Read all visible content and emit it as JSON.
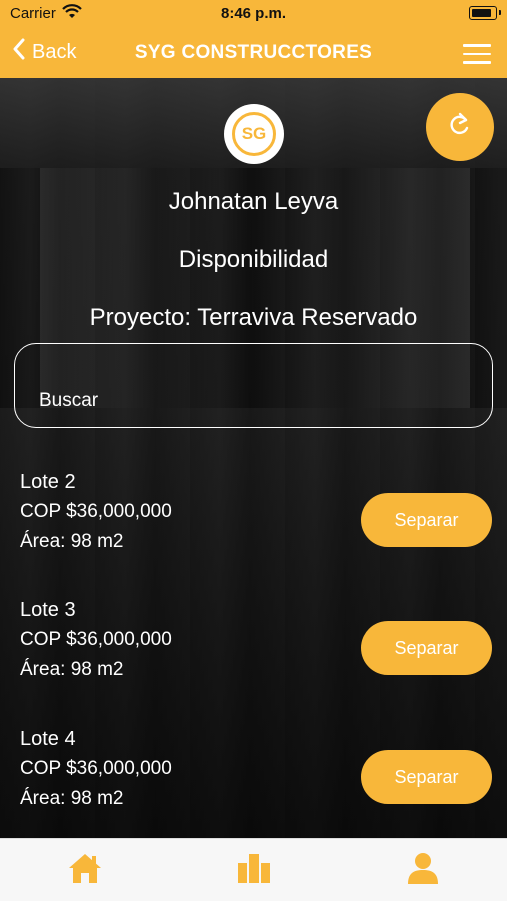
{
  "status_bar": {
    "carrier": "Carrier",
    "time": "8:46 p.m."
  },
  "nav": {
    "back_label": "Back",
    "title": "SYG CONSTRUCCTORES"
  },
  "logo": {
    "text": "SG"
  },
  "profile": {
    "name": "Johnatan Leyva",
    "section": "Disponibilidad",
    "project": "Proyecto: Terraviva Reservado"
  },
  "search": {
    "placeholder": "Buscar",
    "value": ""
  },
  "lots": [
    {
      "name": "Lote 2",
      "price": "COP $36,000,000",
      "area": "Área: 98 m2",
      "button": "Separar"
    },
    {
      "name": "Lote 3",
      "price": "COP $36,000,000",
      "area": "Área: 98 m2",
      "button": "Separar"
    },
    {
      "name": "Lote 4",
      "price": "COP $36,000,000",
      "area": "Área: 98 m2",
      "button": "Separar"
    }
  ],
  "tabs": [
    {
      "icon": "home-icon"
    },
    {
      "icon": "buildings-icon"
    },
    {
      "icon": "user-icon"
    }
  ],
  "colors": {
    "accent": "#f8b73a",
    "text": "#ffffff",
    "tabbar": "#f7f7f7"
  }
}
